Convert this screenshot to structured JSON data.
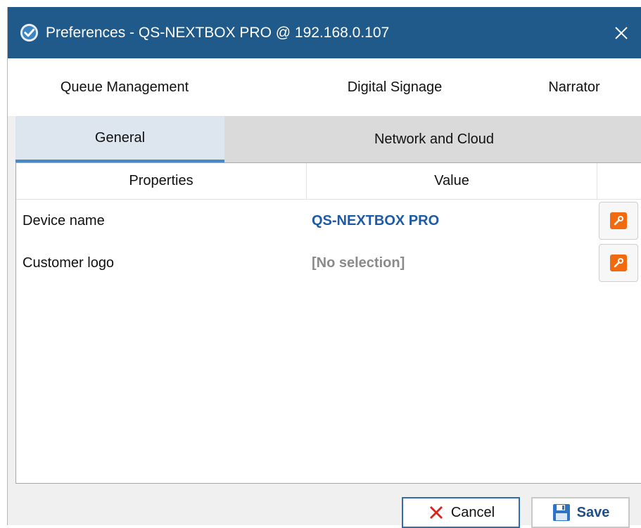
{
  "window": {
    "title": "Preferences - QS-NEXTBOX PRO @ 192.168.0.107",
    "icon": "app-logo-icon",
    "close_icon": "close-icon"
  },
  "tabs_top": [
    {
      "label": "Queue Management"
    },
    {
      "label": "Digital Signage"
    },
    {
      "label": "Narrator"
    }
  ],
  "tabs_bottom": [
    {
      "label": "General",
      "active": true
    },
    {
      "label": "Network and Cloud",
      "active": false
    }
  ],
  "grid": {
    "columns": [
      "Properties",
      "Value",
      ""
    ],
    "rows": [
      {
        "property": "Device name",
        "value": "QS-NEXTBOX PRO",
        "value_color": "#1f5aa6",
        "action_icon": "wrench-icon"
      },
      {
        "property": "Customer logo",
        "value": "[No selection]",
        "value_color": "#8a8a8a",
        "action_icon": "wrench-icon"
      }
    ]
  },
  "buttons": {
    "cancel": {
      "label": "Cancel",
      "icon": "x-icon",
      "icon_color": "#d9231c"
    },
    "save": {
      "label": "Save",
      "icon": "floppy-disk-icon",
      "icon_color": "#2f73c4"
    }
  },
  "colors": {
    "titlebar": "#1f5a8a",
    "active_tab_underline": "#4a88c4",
    "wrench_bg": "#f26a10"
  }
}
